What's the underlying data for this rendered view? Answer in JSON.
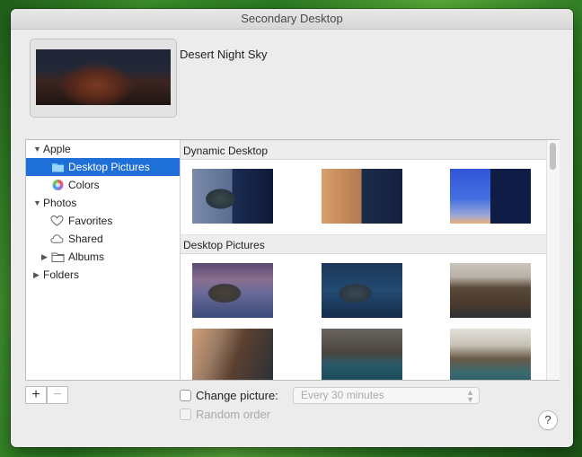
{
  "window": {
    "title": "Secondary Desktop"
  },
  "current": {
    "name": "Desert Night Sky"
  },
  "sidebar": {
    "items": [
      {
        "label": "Apple",
        "icon": "disclosure-open"
      },
      {
        "label": "Desktop Pictures",
        "icon": "folder-icon",
        "selected": true
      },
      {
        "label": "Colors",
        "icon": "color-wheel-icon"
      },
      {
        "label": "Photos",
        "icon": "disclosure-open"
      },
      {
        "label": "Favorites",
        "icon": "heart-icon"
      },
      {
        "label": "Shared",
        "icon": "cloud-icon"
      },
      {
        "label": "Albums",
        "icon": "folder-icon"
      },
      {
        "label": "Folders",
        "icon": "disclosure-closed"
      }
    ]
  },
  "sections": [
    {
      "title": "Dynamic Desktop"
    },
    {
      "title": "Desktop Pictures"
    }
  ],
  "buttons": {
    "add": "+",
    "remove": "−",
    "help": "?"
  },
  "options": {
    "change_picture": "Change picture:",
    "interval": "Every 30 minutes",
    "random_order": "Random order"
  },
  "colors": {
    "selection": "#1f6fd8"
  }
}
